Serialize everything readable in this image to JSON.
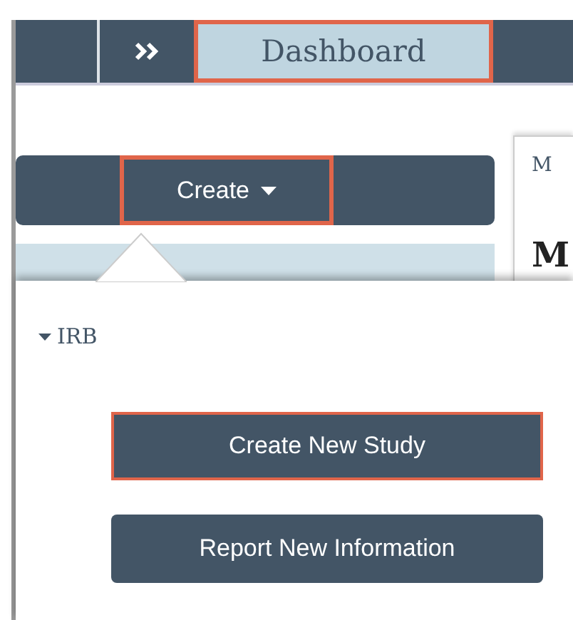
{
  "nav": {
    "tab": {
      "label": "Dashboard",
      "highlighted": true
    }
  },
  "create_menu": {
    "label": "Create",
    "highlighted": true
  },
  "side_panel": {
    "tab_label": "M",
    "heading": "M"
  },
  "popover": {
    "section": {
      "label": "IRB",
      "expanded": true
    },
    "buttons": [
      {
        "label": "Create New Study",
        "highlighted": true
      },
      {
        "label": "Report New Information",
        "highlighted": false
      }
    ]
  }
}
